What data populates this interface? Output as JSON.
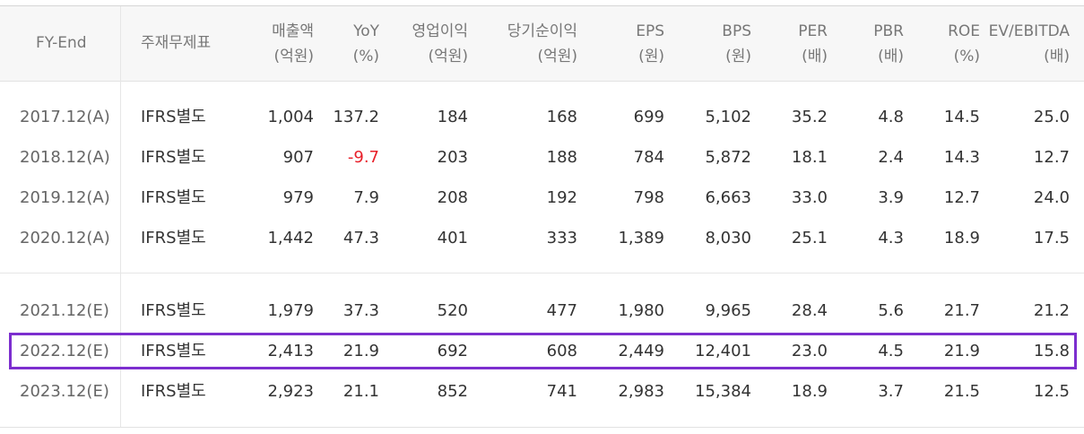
{
  "table": {
    "headers": [
      {
        "key": "fy",
        "line1": "FY-End",
        "line2": ""
      },
      {
        "key": "type",
        "line1": "주재무제표",
        "line2": ""
      },
      {
        "key": "sales",
        "line1": "매출액",
        "line2": "(억원)"
      },
      {
        "key": "yoy",
        "line1": "YoY",
        "line2": "(%)"
      },
      {
        "key": "op",
        "line1": "영업이익",
        "line2": "(억원)"
      },
      {
        "key": "net",
        "line1": "당기순이익",
        "line2": "(억원)"
      },
      {
        "key": "eps",
        "line1": "EPS",
        "line2": "(원)"
      },
      {
        "key": "bps",
        "line1": "BPS",
        "line2": "(원)"
      },
      {
        "key": "per",
        "line1": "PER",
        "line2": "(배)"
      },
      {
        "key": "pbr",
        "line1": "PBR",
        "line2": "(배)"
      },
      {
        "key": "roe",
        "line1": "ROE",
        "line2": "(%)"
      },
      {
        "key": "ev",
        "line1": "EV/EBITDA",
        "line2": "(배)"
      }
    ],
    "rows": [
      {
        "fy": "2017.12(A)",
        "type": "IFRS별도",
        "sales": "1,004",
        "yoy": "137.2",
        "op": "184",
        "net": "168",
        "eps": "699",
        "bps": "5,102",
        "per": "35.2",
        "pbr": "4.8",
        "roe": "14.5",
        "ev": "25.0"
      },
      {
        "fy": "2018.12(A)",
        "type": "IFRS별도",
        "sales": "907",
        "yoy": "-9.7",
        "op": "203",
        "net": "188",
        "eps": "784",
        "bps": "5,872",
        "per": "18.1",
        "pbr": "2.4",
        "roe": "14.3",
        "ev": "12.7"
      },
      {
        "fy": "2019.12(A)",
        "type": "IFRS별도",
        "sales": "979",
        "yoy": "7.9",
        "op": "208",
        "net": "192",
        "eps": "798",
        "bps": "6,663",
        "per": "33.0",
        "pbr": "3.9",
        "roe": "12.7",
        "ev": "24.0"
      },
      {
        "fy": "2020.12(A)",
        "type": "IFRS별도",
        "sales": "1,442",
        "yoy": "47.3",
        "op": "401",
        "net": "333",
        "eps": "1,389",
        "bps": "8,030",
        "per": "25.1",
        "pbr": "4.3",
        "roe": "18.9",
        "ev": "17.5"
      },
      {
        "fy": "2021.12(E)",
        "type": "IFRS별도",
        "sales": "1,979",
        "yoy": "37.3",
        "op": "520",
        "net": "477",
        "eps": "1,980",
        "bps": "9,965",
        "per": "28.4",
        "pbr": "5.6",
        "roe": "21.7",
        "ev": "21.2"
      },
      {
        "fy": "2022.12(E)",
        "type": "IFRS별도",
        "sales": "2,413",
        "yoy": "21.9",
        "op": "692",
        "net": "608",
        "eps": "2,449",
        "bps": "12,401",
        "per": "23.0",
        "pbr": "4.5",
        "roe": "21.9",
        "ev": "15.8"
      },
      {
        "fy": "2023.12(E)",
        "type": "IFRS별도",
        "sales": "2,923",
        "yoy": "21.1",
        "op": "852",
        "net": "741",
        "eps": "2,983",
        "bps": "15,384",
        "per": "18.9",
        "pbr": "3.7",
        "roe": "21.5",
        "ev": "12.5"
      }
    ],
    "highlighted_row": "2022.12(E)"
  },
  "colors": {
    "negative": "#e8202a",
    "highlight_border": "#7c2ecf",
    "header_bg": "#f7f7f7"
  }
}
